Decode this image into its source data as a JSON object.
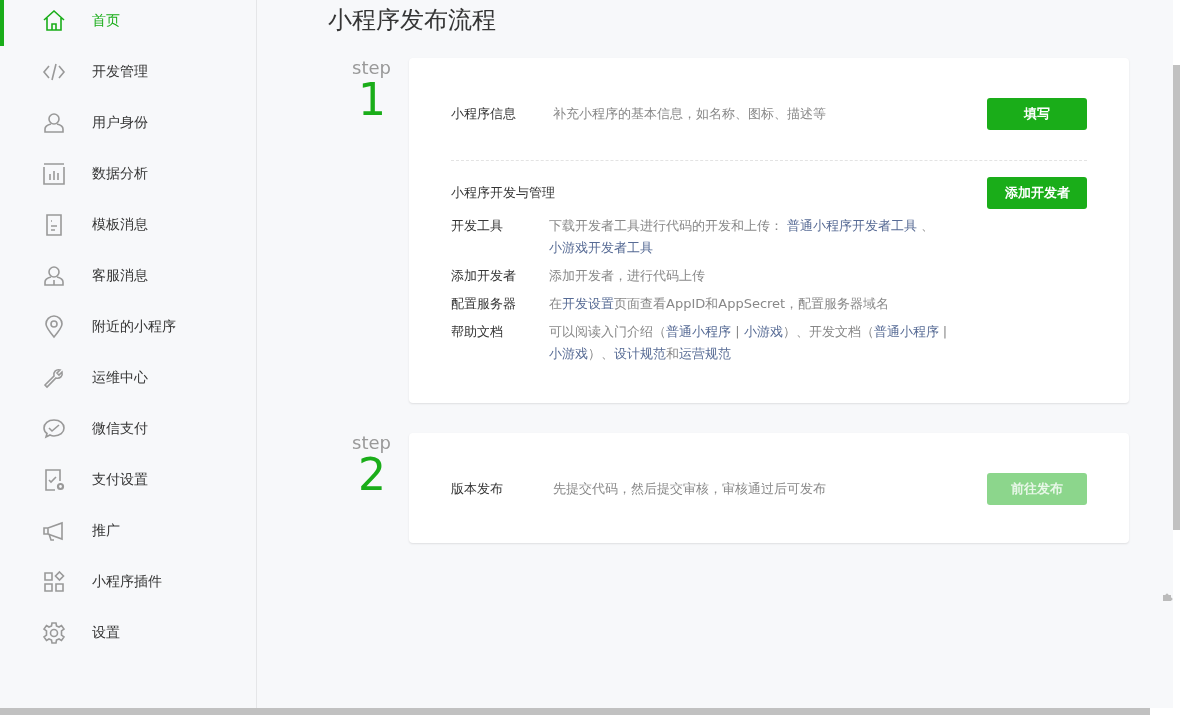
{
  "sidebar": {
    "items": [
      {
        "label": "首页",
        "kind": "home",
        "selected": true
      },
      {
        "label": "开发管理",
        "kind": "code",
        "selected": false
      },
      {
        "label": "用户身份",
        "kind": "user",
        "selected": false
      },
      {
        "label": "数据分析",
        "kind": "chart",
        "selected": false
      },
      {
        "label": "模板消息",
        "kind": "doc",
        "selected": false
      },
      {
        "label": "客服消息",
        "kind": "service",
        "selected": false
      },
      {
        "label": "附近的小程序",
        "kind": "pin",
        "selected": false
      },
      {
        "label": "运维中心",
        "kind": "wrench",
        "selected": false
      },
      {
        "label": "微信支付",
        "kind": "pay",
        "selected": false
      },
      {
        "label": "支付设置",
        "kind": "paysettings",
        "selected": false
      },
      {
        "label": "推广",
        "kind": "megaphone",
        "selected": false
      },
      {
        "label": "小程序插件",
        "kind": "plugin",
        "selected": false
      },
      {
        "label": "设置",
        "kind": "gear",
        "selected": false
      }
    ]
  },
  "page_title": "小程序发布流程",
  "steps": [
    {
      "step_label": "step",
      "number": "1",
      "sections": [
        {
          "kind": "row",
          "label": "小程序信息",
          "description": "补充小程序的基本信息，如名称、图标、描述等",
          "button": {
            "label": "填写",
            "disabled": false
          }
        },
        {
          "kind": "list",
          "title": "小程序开发与管理",
          "button": {
            "label": "添加开发者",
            "disabled": false
          },
          "items": [
            {
              "label": "开发工具",
              "parts": [
                {
                  "kind": "text",
                  "text": "下载开发者工具进行代码的开发和上传： "
                },
                {
                  "kind": "link",
                  "text": "普通小程序开发者工具"
                },
                {
                  "kind": "text",
                  "text": " 、 "
                },
                {
                  "kind": "link",
                  "text": "小游戏开发者工具"
                }
              ]
            },
            {
              "label": "添加开发者",
              "parts": [
                {
                  "kind": "text",
                  "text": "添加开发者，进行代码上传"
                }
              ]
            },
            {
              "label": "配置服务器",
              "parts": [
                {
                  "kind": "text",
                  "text": "在"
                },
                {
                  "kind": "link",
                  "text": "开发设置"
                },
                {
                  "kind": "text",
                  "text": "页面查看AppID和AppSecret，配置服务器域名"
                }
              ]
            },
            {
              "label": "帮助文档",
              "parts": [
                {
                  "kind": "text",
                  "text": "可以阅读入门介绍（"
                },
                {
                  "kind": "link",
                  "text": "普通小程序"
                },
                {
                  "kind": "text",
                  "text": " | "
                },
                {
                  "kind": "link",
                  "text": "小游戏"
                },
                {
                  "kind": "text",
                  "text": "）、开发文档（"
                },
                {
                  "kind": "link",
                  "text": "普通小程序"
                },
                {
                  "kind": "text",
                  "text": " | "
                },
                {
                  "kind": "link",
                  "text": "小游戏"
                },
                {
                  "kind": "text",
                  "text": "）、"
                },
                {
                  "kind": "link",
                  "text": "设计规范"
                },
                {
                  "kind": "text",
                  "text": "和"
                },
                {
                  "kind": "link",
                  "text": "运营规范"
                }
              ]
            }
          ]
        }
      ]
    },
    {
      "step_label": "step",
      "number": "2",
      "sections": [
        {
          "kind": "row",
          "label": "版本发布",
          "description": "先提交代码，然后提交审核，审核通过后可发布",
          "button": {
            "label": "前往发布",
            "disabled": true
          }
        }
      ]
    }
  ]
}
